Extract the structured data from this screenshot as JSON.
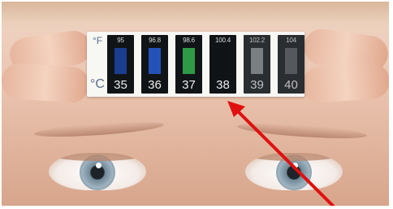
{
  "thermometer": {
    "unit_f": "°F",
    "unit_c": "°C",
    "cells": [
      {
        "f": "95",
        "c": "35",
        "color": "#1b3d8f",
        "state": "lit"
      },
      {
        "f": "96.8",
        "c": "36",
        "color": "#2352b8",
        "state": "lit"
      },
      {
        "f": "98.6",
        "c": "37",
        "color": "#2e9a46",
        "state": "lit"
      },
      {
        "f": "100.4",
        "c": "38",
        "color": "#101315",
        "state": "dark"
      },
      {
        "f": "102.2",
        "c": "39",
        "color": "#7a7f84",
        "state": "faded"
      },
      {
        "f": "104",
        "c": "40",
        "color": "#55595d",
        "state": "faded"
      }
    ]
  },
  "annotation": {
    "arrow_color": "#e01010",
    "points_to_reading": "38"
  }
}
